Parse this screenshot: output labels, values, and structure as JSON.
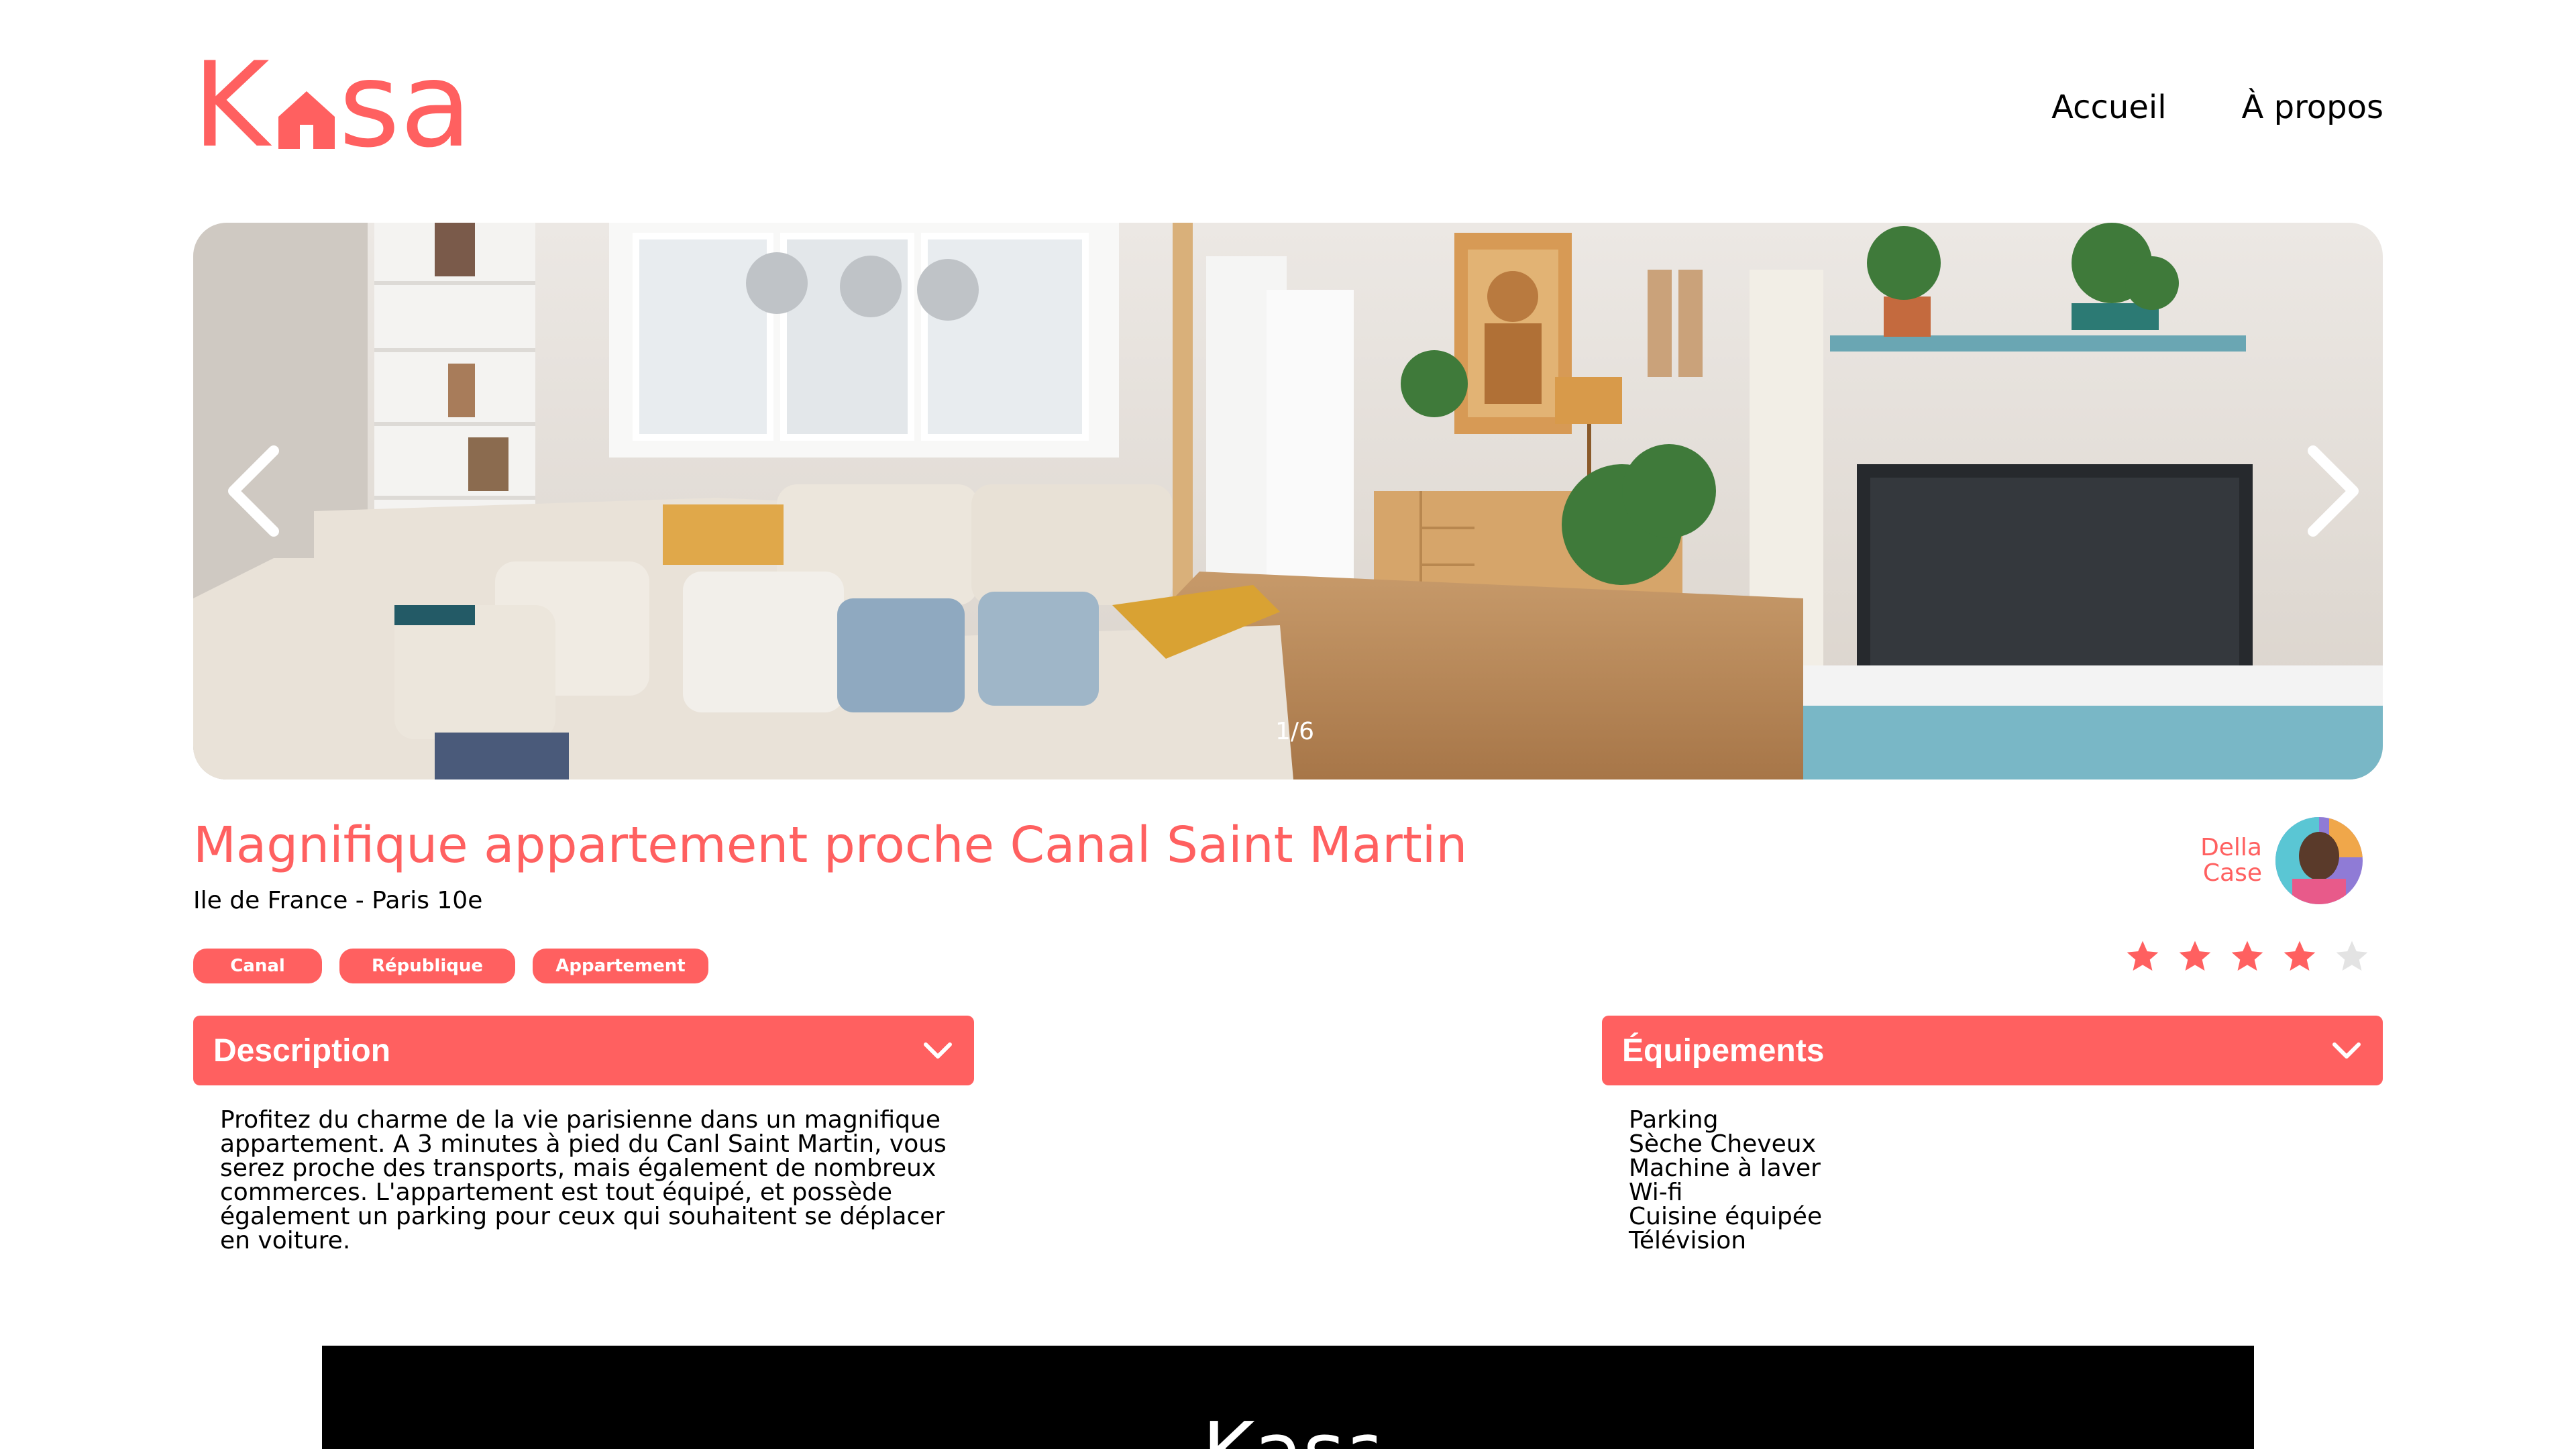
{
  "brand": {
    "logo_letters": "Kasa",
    "accent_color": "#FF6060"
  },
  "nav": {
    "items": [
      {
        "label": "Accueil"
      },
      {
        "label": "À propos"
      }
    ]
  },
  "gallery": {
    "counter": "1/6",
    "prev_icon": "chevron-left-icon",
    "next_icon": "chevron-right-icon"
  },
  "listing": {
    "title": "Magnifique appartement proche Canal Saint Martin",
    "location": "Ile de France - Paris 10e",
    "tags": [
      "Canal",
      "République",
      "Appartement"
    ],
    "rating": 4,
    "rating_max": 5
  },
  "host": {
    "first_name": "Della",
    "last_name": "Case"
  },
  "description": {
    "title": "Description",
    "text": "Profitez du charme de la vie parisienne dans un magnifique appartement. A 3 minutes à pied du Canl Saint Martin, vous serez proche des transports, mais également de nombreux commerces. L'appartement est tout équipé, et possède également un parking pour ceux qui souhaitent se déplacer en voiture."
  },
  "equipments": {
    "title": "Équipements",
    "items": [
      "Parking",
      "Sèche Cheveux",
      "Machine à laver",
      "Wi-fi",
      "Cuisine équipée",
      "Télévision"
    ]
  }
}
